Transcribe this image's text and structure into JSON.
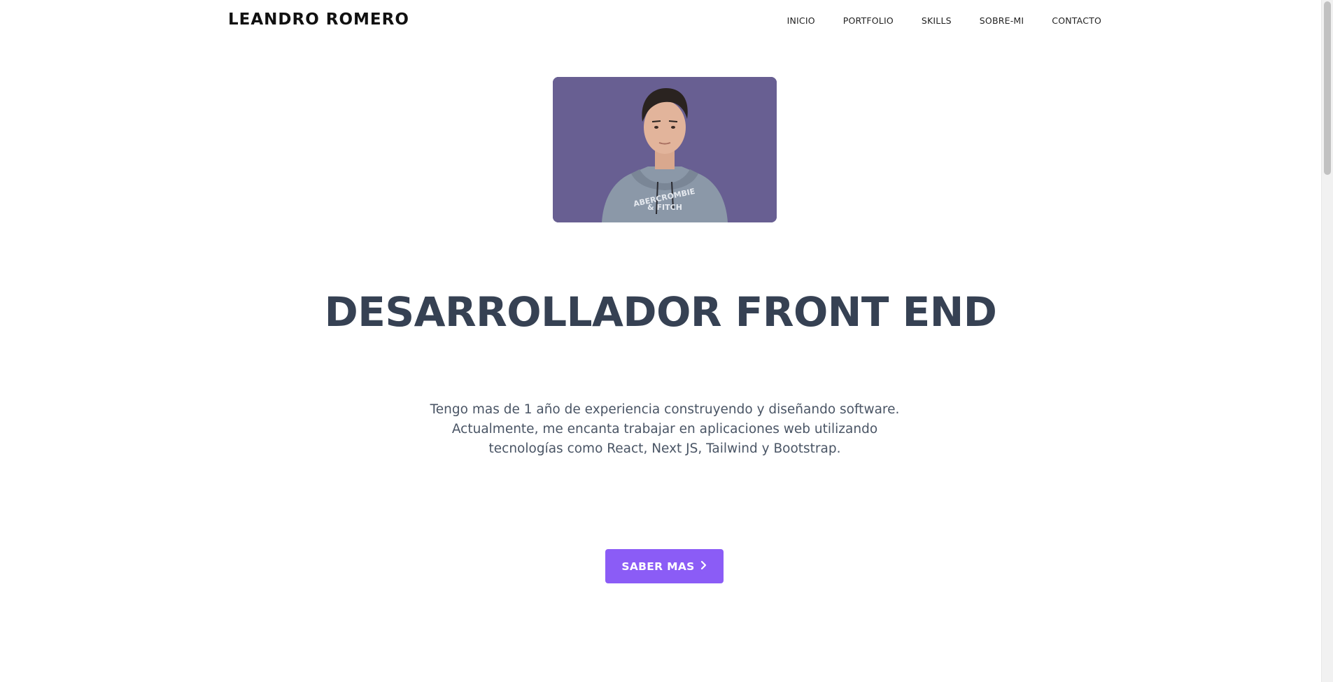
{
  "header": {
    "brand": "LEANDRO ROMERO",
    "nav": [
      {
        "label": "INICIO"
      },
      {
        "label": "PORTFOLIO"
      },
      {
        "label": "SKILLS"
      },
      {
        "label": "SOBRE-MI"
      },
      {
        "label": "CONTACTO"
      }
    ]
  },
  "hero": {
    "photo_icon": "profile-photo",
    "photo_bg_color": "#685f92",
    "title": "DESARROLLADOR FRONT END",
    "description_lines": [
      "Tengo mas de 1 año de experiencia construyendo y diseñando software.",
      "Actualmente, me encanta trabajar en aplicaciones web utilizando",
      "tecnologías como React, Next JS, Tailwind y Bootstrap."
    ],
    "cta_label": "SABER MAS",
    "cta_icon": "chevron-right-icon"
  },
  "colors": {
    "accent": "#8b5cf6",
    "title": "#364153",
    "body_text": "#4a5565"
  }
}
